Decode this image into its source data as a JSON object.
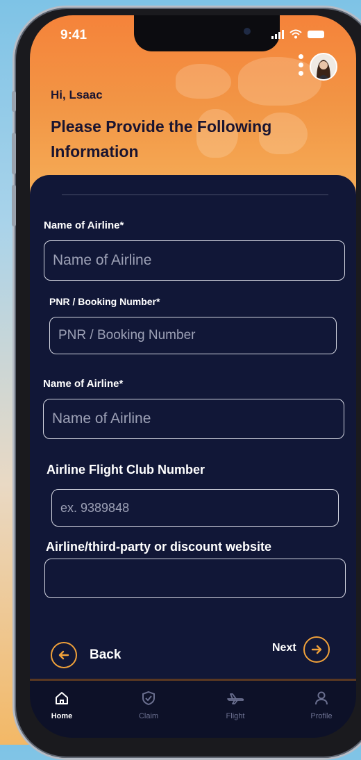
{
  "status": {
    "time": "9:41"
  },
  "header": {
    "greeting": "Hi, Lsaac",
    "title": "Please Provide the Following Information"
  },
  "form": {
    "field1": {
      "label": "Name of Airline*",
      "placeholder": "Name of Airline"
    },
    "field2": {
      "label": "PNR / Booking Number*",
      "placeholder": "PNR / Booking Number"
    },
    "field3": {
      "label": "Name of Airline*",
      "placeholder": "Name of Airline"
    },
    "field4": {
      "label": "Airline Flight Club Number",
      "placeholder": "ex. 9389848"
    },
    "field5": {
      "label": "Airline/third-party or discount website",
      "placeholder": ""
    }
  },
  "nav": {
    "back": "Back",
    "next": "Next"
  },
  "tabs": [
    {
      "label": "Home",
      "icon": "home-icon",
      "active": true
    },
    {
      "label": "Claim",
      "icon": "shield-icon",
      "active": false
    },
    {
      "label": "Flight",
      "icon": "plane-icon",
      "active": false
    },
    {
      "label": "Profile",
      "icon": "user-icon",
      "active": false
    }
  ],
  "colors": {
    "accent": "#f0a13a",
    "header": "#f5833a",
    "panel": "#111737"
  }
}
